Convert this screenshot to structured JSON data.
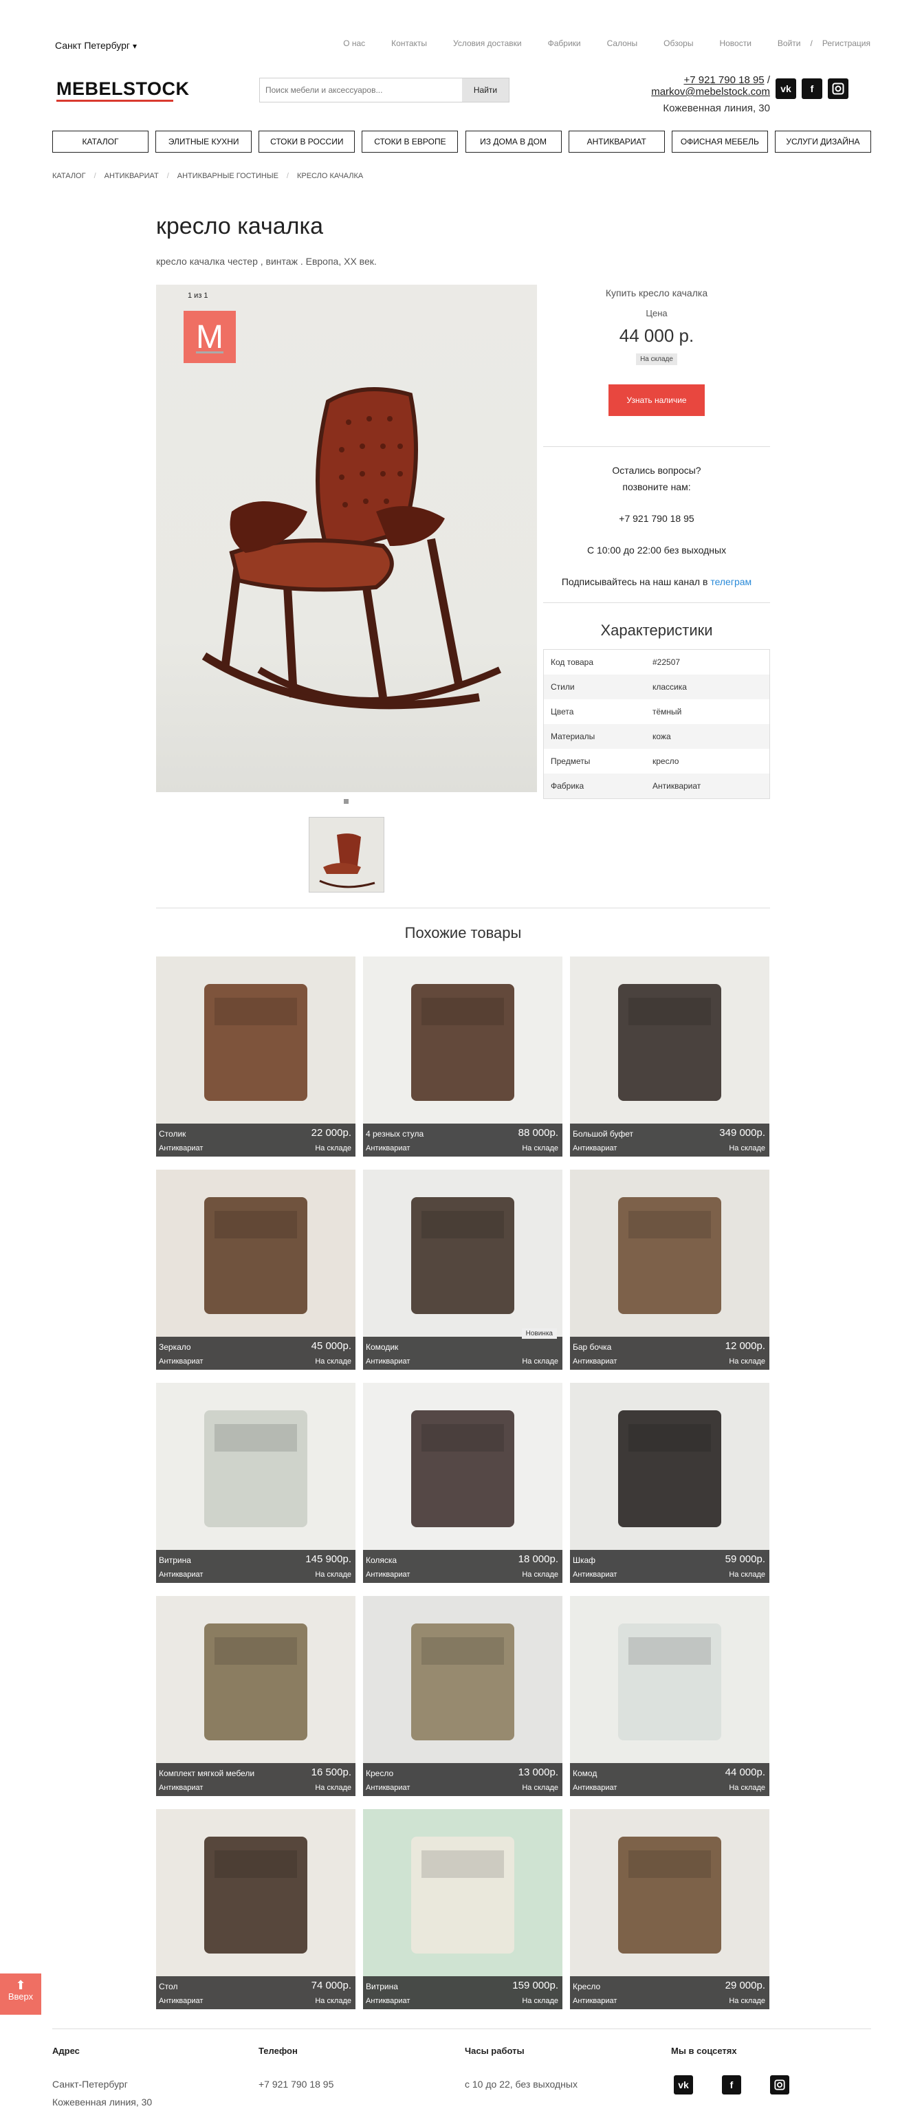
{
  "topbar": {
    "city": "Санкт Петербург",
    "nav": [
      "О нас",
      "Контакты",
      "Условия доставки",
      "Фабрики",
      "Салоны",
      "Обзоры",
      "Новости",
      "Войти"
    ],
    "register": "Регистрация",
    "separator": "/"
  },
  "header": {
    "logo": "MEBELSTOCK",
    "search_placeholder": "Поиск мебели и аксессуаров...",
    "search_button": "Найти",
    "phone": "+7 921 790 18 95",
    "email": "markov@mebelstock.com",
    "contact_sep": "/",
    "address": "Кожевенная линия, 30",
    "social": [
      "vk",
      "f",
      "ig"
    ]
  },
  "menu": [
    "КАТАЛОГ",
    "ЭЛИТНЫЕ КУХНИ",
    "СТОКИ В РОССИИ",
    "СТОКИ В ЕВРОПЕ",
    "ИЗ ДОМА В ДОМ",
    "АНТИКВАРИАТ",
    "ОФИСНАЯ МЕБЕЛЬ",
    "УСЛУГИ ДИЗАЙНА"
  ],
  "breadcrumbs": [
    "КАТАЛОГ",
    "АНТИКВАРИАТ",
    "АНТИКВАРНЫЕ ГОСТИНЫЕ",
    "КРЕСЛО КАЧАЛКА"
  ],
  "product": {
    "title": "кресло качалка",
    "subtitle": "кресло качалка честер , винтаж . Европа, XX век.",
    "counter": "1 из 1",
    "buy_title": "Купить кресло качалка",
    "price_label": "Цена",
    "price": "44 000 р.",
    "stock": "На складе",
    "availability_button": "Узнать наличие"
  },
  "questions": {
    "line1": "Остались вопросы?",
    "line2": "позвоните нам:",
    "phone": "+7 921 790 18 95",
    "hours": "С 10:00 до 22:00 без выходных",
    "tg_text": "Подписывайтесь на наш канал в",
    "tg_link": "телеграм"
  },
  "characteristics": {
    "heading": "Характеристики",
    "rows": [
      {
        "k": "Код товара",
        "v": "#22507"
      },
      {
        "k": "Стили",
        "v": "классика"
      },
      {
        "k": "Цвета",
        "v": "тёмный"
      },
      {
        "k": "Материалы",
        "v": "кожа"
      },
      {
        "k": "Предметы",
        "v": "кресло"
      },
      {
        "k": "Фабрика",
        "v": "Антиквариат"
      }
    ]
  },
  "similar": {
    "heading": "Похожие товары",
    "items": [
      {
        "name": "Столик",
        "price": "22 000р.",
        "brand": "Антиквариат",
        "avail": "На складе",
        "badge": ""
      },
      {
        "name": "4 резных стула",
        "price": "88 000р.",
        "brand": "Антиквариат",
        "avail": "На складе",
        "badge": ""
      },
      {
        "name": "Большой буфет",
        "price": "349 000р.",
        "brand": "Антиквариат",
        "avail": "На складе",
        "badge": ""
      },
      {
        "name": "Зеркало",
        "price": "45 000р.",
        "brand": "Антиквариат",
        "avail": "На складе",
        "badge": ""
      },
      {
        "name": "Комодик",
        "price": "",
        "brand": "Антиквариат",
        "avail": "На складе",
        "badge": "Новинка"
      },
      {
        "name": "Бар бочка",
        "price": "12 000р.",
        "brand": "Антиквариат",
        "avail": "На складе",
        "badge": ""
      },
      {
        "name": "Витрина",
        "price": "145 900р.",
        "brand": "Антиквариат",
        "avail": "На складе",
        "badge": ""
      },
      {
        "name": "Коляска",
        "price": "18 000р.",
        "brand": "Антиквариат",
        "avail": "На складе",
        "badge": ""
      },
      {
        "name": "Шкаф",
        "price": "59 000р.",
        "brand": "Антиквариат",
        "avail": "На складе",
        "badge": ""
      },
      {
        "name": "Комплект мягкой мебели",
        "price": "16 500р.",
        "brand": "Антиквариат",
        "avail": "На складе",
        "badge": ""
      },
      {
        "name": "Кресло",
        "price": "13 000р.",
        "brand": "Антиквариат",
        "avail": "На складе",
        "badge": ""
      },
      {
        "name": "Комод",
        "price": "44 000р.",
        "brand": "Антиквариат",
        "avail": "На складе",
        "badge": ""
      },
      {
        "name": "Стол",
        "price": "74 000р.",
        "brand": "Антиквариат",
        "avail": "На складе",
        "badge": ""
      },
      {
        "name": "Витрина",
        "price": "159 000р.",
        "brand": "Антиквариат",
        "avail": "На складе",
        "badge": ""
      },
      {
        "name": "Кресло",
        "price": "29 000р.",
        "brand": "Антиквариат",
        "avail": "На складе",
        "badge": ""
      }
    ]
  },
  "up_button": "Вверх",
  "footer": {
    "address_h": "Адрес",
    "address_1": "Санкт-Петербург",
    "address_2": "Кожевенная линия, 30",
    "phone_h": "Телефон",
    "phone": "+7 921 790 18 95",
    "hours_h": "Часы работы",
    "hours": "с 10 до 22, без выходных",
    "social_h": "Мы в соцсетях"
  },
  "colors": {
    "accent": "#e8473f",
    "logo_bg": "#ef6f63",
    "link": "#2a8ad8"
  }
}
